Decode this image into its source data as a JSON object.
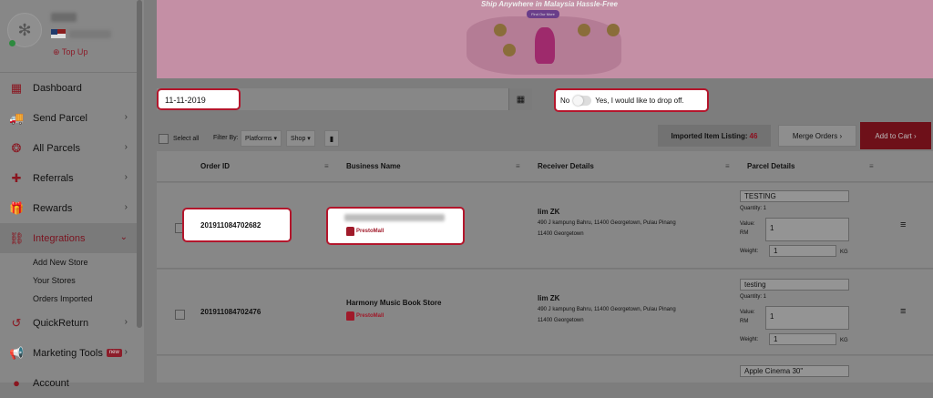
{
  "sidebar": {
    "topup": "⊕ Top Up",
    "items": [
      {
        "label": "Dashboard",
        "icon": "▦"
      },
      {
        "label": "Send Parcel",
        "icon": "🚚"
      },
      {
        "label": "All Parcels",
        "icon": "❂"
      },
      {
        "label": "Referrals",
        "icon": "✚"
      },
      {
        "label": "Rewards",
        "icon": "🎁"
      },
      {
        "label": "Integrations",
        "icon": "⛓"
      },
      {
        "label": "QuickReturn",
        "icon": "↺"
      },
      {
        "label": "Marketing Tools",
        "icon": "📢",
        "badge": "new"
      },
      {
        "label": "Account",
        "icon": "●"
      }
    ],
    "integrations_sub": [
      "Add New Store",
      "Your Stores",
      "Orders Imported"
    ]
  },
  "banner": {
    "title": "Ship Anywhere in Malaysia Hassle-Free",
    "button": "Find Our More"
  },
  "filters": {
    "date": "11-11-2019",
    "drop_off_no": "No",
    "drop_off_yes": "Yes, I would like to drop off."
  },
  "toolbar": {
    "select_all": "Select all",
    "filter_by": "Filter By:",
    "platforms": "Platforms ▾",
    "shop": "Shop ▾",
    "imported_label": "Imported Item Listing:",
    "imported_count": "46",
    "merge": "Merge Orders ›",
    "add_to_cart": "Add to Cart ›"
  },
  "table": {
    "headers": [
      "Order ID",
      "Business Name",
      "Receiver Details",
      "Parcel Details"
    ],
    "rows": [
      {
        "order_id": "201911084702682",
        "business": "",
        "brand": "PrestoMall",
        "receiver_name": "lim ZK",
        "receiver_addr": "490 J kampung Bahru, 11400 Georgetown, Pulau Pinang 11400 Georgetown",
        "parcel_name": "TESTING",
        "quantity": "Quantity: 1",
        "value_label": "Value:",
        "value_unit": "RM",
        "value": "1",
        "weight_label": "Weight:",
        "weight": "1",
        "weight_unit": "KG"
      },
      {
        "order_id": "201911084702476",
        "business": "Harmony Music Book Store",
        "brand": "PrestoMall",
        "receiver_name": "lim ZK",
        "receiver_addr": "490 J kampung Bahru, 11400 Georgetown, Pulau Pinang 11400 Georgetown",
        "parcel_name": "testing",
        "quantity": "Quantity: 1",
        "value_label": "Value:",
        "value_unit": "RM",
        "value": "1",
        "weight_label": "Weight:",
        "weight": "1",
        "weight_unit": "KG"
      },
      {
        "parcel_name": "Apple Cinema 30\""
      }
    ]
  }
}
